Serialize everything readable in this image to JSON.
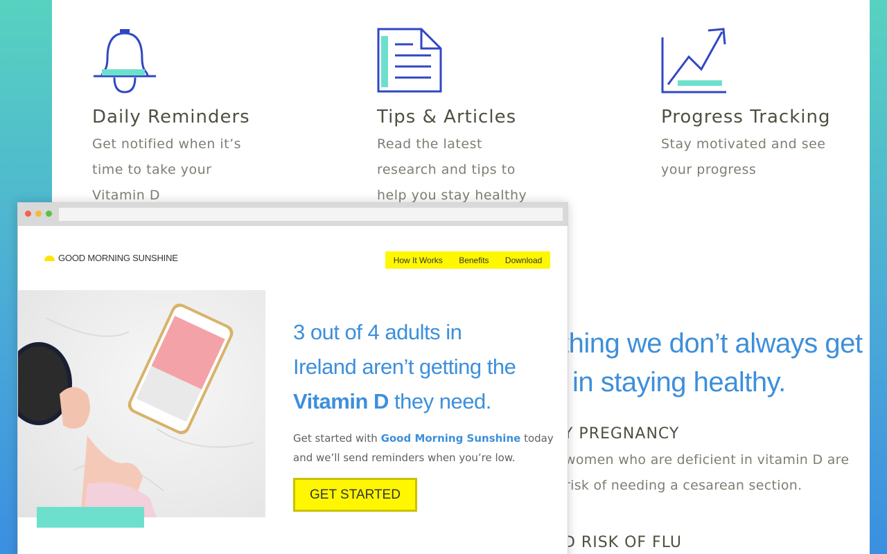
{
  "features": [
    {
      "icon": "bell-icon",
      "title": "Daily Reminders",
      "lines": [
        "Get notified when it’s",
        "time to take your",
        "Vitamin D"
      ]
    },
    {
      "icon": "document-icon",
      "title": "Tips & Articles",
      "lines": [
        "Read the latest",
        "research and tips to",
        "help you stay healthy"
      ]
    },
    {
      "icon": "trend-chart-icon",
      "title": "Progress Tracking",
      "lines": [
        "Stay motivated and see",
        "your progress"
      ]
    }
  ],
  "background_section": {
    "headline_line1": "thing we don’t always get",
    "headline_line2": "in staying healthy.",
    "items": [
      {
        "title": "Y PREGNANCY",
        "text_line1": "women who are deficient in vitamin D are",
        "text_line2": "risk of needing a cesarean section."
      },
      {
        "title": "D RISK OF FLU"
      }
    ]
  },
  "mockup": {
    "logo_text": "GOOD MORNING SUNSHINE",
    "nav": [
      "How It Works",
      "Benefits",
      "Download"
    ],
    "hero": {
      "title_line1": "3 out of 4 adults in",
      "title_line2": "Ireland aren’t getting the",
      "title_strong": "Vitamin D",
      "title_end": " they need.",
      "sub_prefix": "Get started with ",
      "sub_brand": "Good Morning Sunshine",
      "sub_suffix": " today",
      "sub_line2": "and we’ll send reminders when you’re low.",
      "cta": "GET STARTED"
    }
  },
  "colors": {
    "accent_blue": "#3d8fdb",
    "yellow": "#fff700",
    "teal": "#6de0cd",
    "icon_blue": "#2f47c4"
  }
}
